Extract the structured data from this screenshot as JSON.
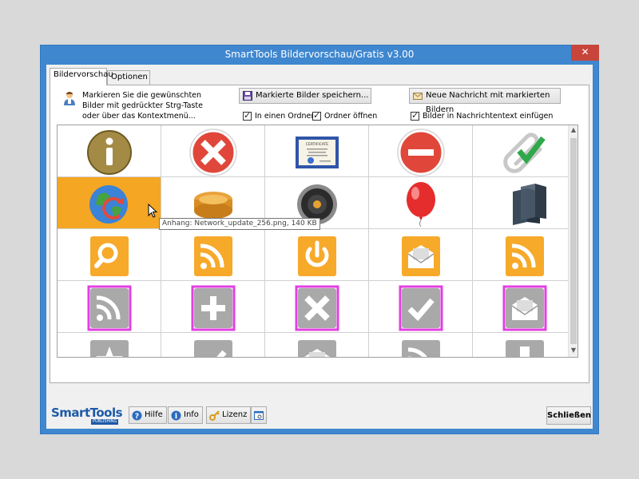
{
  "window": {
    "title": "SmartTools Bildervorschau/Gratis v3.00",
    "close_glyph": "✕"
  },
  "tabs": [
    {
      "label": "Bildervorschau",
      "active": true
    },
    {
      "label": "Optionen",
      "active": false
    }
  ],
  "hint": {
    "text": "Markieren Sie die gewünschten\nBilder mit gedrückter Strg-Taste\noder über das Kontextmenü...",
    "icon": "user-info-icon"
  },
  "actions": {
    "save_button": "Markierte Bilder speichern...",
    "message_button": "Neue Nachricht mit markierten Bildern",
    "check_folder": "In einen Ordner",
    "check_open": "Ordner öffnen",
    "check_insert": "Bilder in Nachrichtentext einfügen"
  },
  "grid": {
    "rows": [
      [
        "info-icon",
        "error-icon",
        "certificate-icon",
        "stop-icon",
        "paperclip-check-icon"
      ],
      [
        "network-update-icon",
        "coins-icon",
        "speaker-icon",
        "balloon-icon",
        "servers-icon"
      ],
      [
        "orange-search-icon",
        "orange-rss-icon",
        "orange-power-icon",
        "orange-mail-open-icon",
        "orange-rss-icon"
      ],
      [
        "gray-rss-icon",
        "gray-plus-icon",
        "gray-close-icon",
        "gray-check-icon",
        "gray-mail-open-icon"
      ],
      [
        "gray-star-icon",
        "gray-check-icon",
        "gray-mail-open-icon",
        "gray-rss-icon",
        "gray-download-icon"
      ]
    ],
    "selected_cell": "network-update-icon",
    "marked_cells": [
      "gray-rss-icon",
      "gray-plus-icon",
      "gray-close-icon",
      "gray-check-icon",
      "gray-mail-open-icon"
    ]
  },
  "tooltip": {
    "text": "Anhang: Network_update_256.png, 140 KB"
  },
  "footer": {
    "logo_text": "SmartTools",
    "logo_sub": "PUBLISHING",
    "help_button": "Hilfe",
    "info_button": "Info",
    "license_button": "Lizenz",
    "close_button": "Schließen"
  },
  "colors": {
    "titlebar": "#3f87cf",
    "selected": "#f5a623",
    "mark": "#e23fe2",
    "orange_tile": "#f7a92a",
    "gray_tile": "#a9a9a9"
  }
}
